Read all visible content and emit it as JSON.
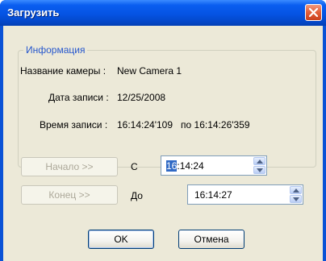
{
  "window": {
    "title": "Загрузить"
  },
  "info": {
    "group_title": "Информация",
    "camera_label": "Название камеры :",
    "camera_value": "New Camera 1",
    "date_label": "Дата записи :",
    "date_value": "12/25/2008",
    "time_label": "Время записи :",
    "time_value": "16:14:24'109   по 16:14:26'359"
  },
  "range": {
    "start_button": "Начало >>",
    "from_label": "С",
    "from_selected": "16",
    "from_rest": ":14:24",
    "end_button": "Конец >>",
    "to_label": "До",
    "to_value": "16:14:27"
  },
  "buttons": {
    "ok": "OK",
    "cancel": "Отмена"
  },
  "icons": {
    "close": "close-icon",
    "spin_up": "arrow-up-icon",
    "spin_down": "arrow-down-icon"
  }
}
